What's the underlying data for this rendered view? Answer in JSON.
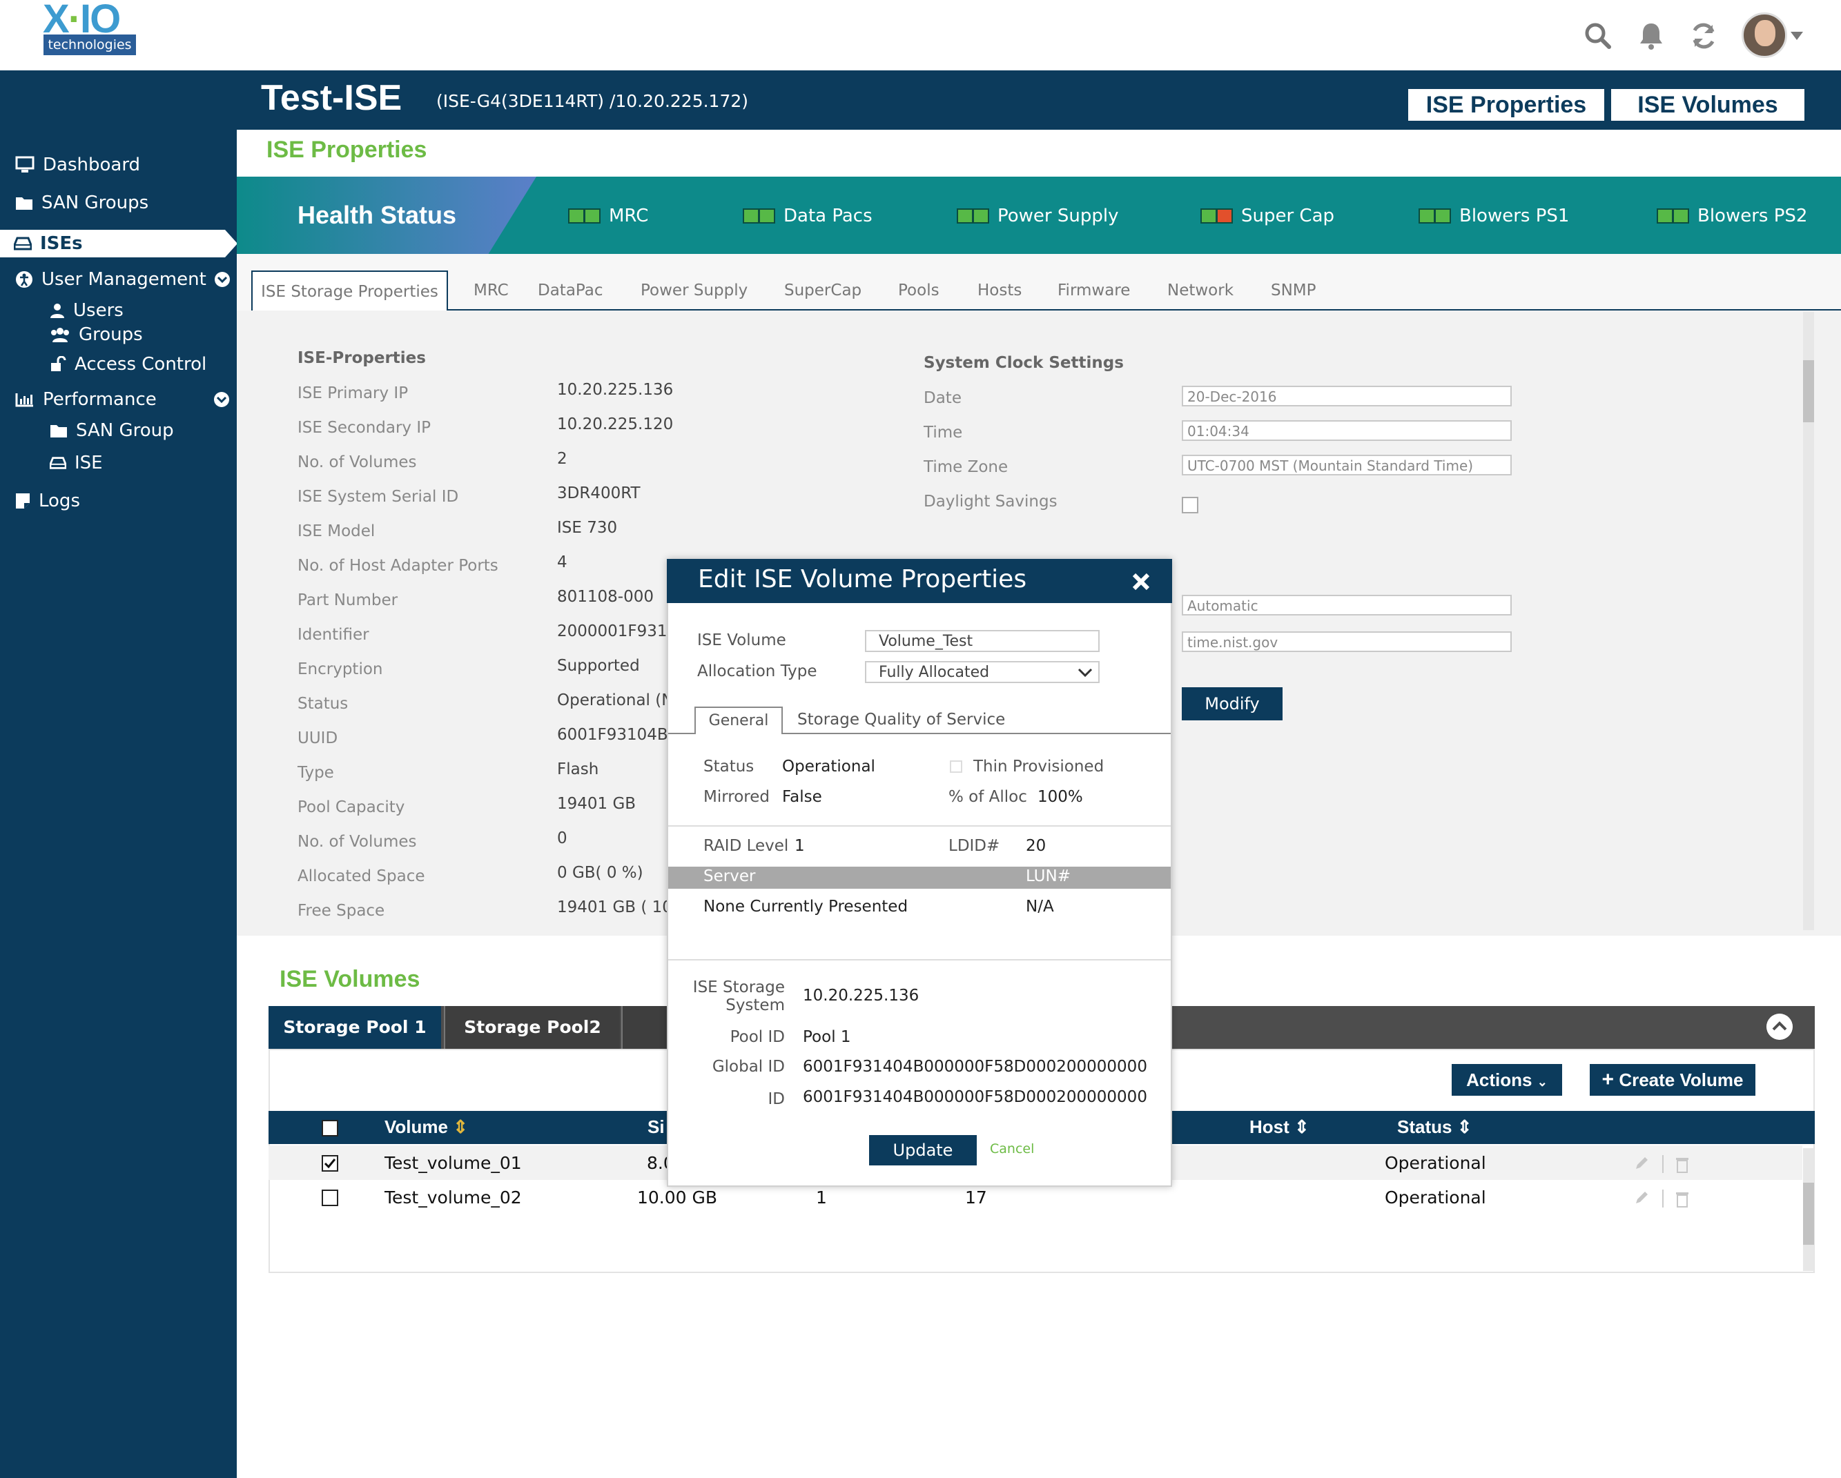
{
  "brand": {
    "logo_main": "X-IO",
    "logo_sub": "technologies"
  },
  "topbar_icons": [
    "search-icon",
    "bell-icon",
    "refresh-icon",
    "user-avatar"
  ],
  "sidebar": {
    "items": [
      {
        "label": "Dashboard",
        "icon": "monitor-icon"
      },
      {
        "label": "SAN Groups",
        "icon": "folder-icon"
      },
      {
        "label": "ISEs",
        "icon": "drive-icon",
        "active": true
      },
      {
        "label": "User Management",
        "icon": "accessibility-icon"
      },
      {
        "label": "Users",
        "icon": "user-icon"
      },
      {
        "label": "Groups",
        "icon": "users-icon"
      },
      {
        "label": "Access Control",
        "icon": "unlock-icon"
      },
      {
        "label": "Performance",
        "icon": "bar-chart-icon"
      },
      {
        "label": "SAN Group",
        "icon": "folder-icon"
      },
      {
        "label": "ISE",
        "icon": "drive-icon"
      },
      {
        "label": "Logs",
        "icon": "note-icon"
      }
    ]
  },
  "header": {
    "title": "Test-ISE",
    "subtitle": "(ISE-G4(3DE114RT) /10.20.225.172)",
    "btn_properties": "ISE Properties",
    "btn_volumes": "ISE Volumes"
  },
  "section_properties_title": "ISE Properties",
  "health": {
    "label": "Health Status",
    "items": [
      {
        "label": "MRC",
        "leds": [
          "green",
          "green"
        ]
      },
      {
        "label": "Data Pacs",
        "leds": [
          "green",
          "green"
        ]
      },
      {
        "label": "Power Supply",
        "leds": [
          "green",
          "green"
        ]
      },
      {
        "label": "Super Cap",
        "leds": [
          "green",
          "red"
        ]
      },
      {
        "label": "Blowers PS1",
        "leds": [
          "green",
          "green"
        ]
      },
      {
        "label": "Blowers PS2",
        "leds": [
          "green",
          "green"
        ]
      }
    ]
  },
  "tabs": [
    "ISE Storage Properties",
    "MRC",
    "DataPac",
    "Power Supply",
    "SuperCap",
    "Pools",
    "Hosts",
    "Firmware",
    "Network",
    "SNMP"
  ],
  "properties": {
    "heading": "ISE-Properties",
    "rows": [
      {
        "label": "ISE Primary IP",
        "value": "10.20.225.136"
      },
      {
        "label": "ISE Secondary IP",
        "value": "10.20.225.120"
      },
      {
        "label": "No. of Volumes",
        "value": "2"
      },
      {
        "label": "ISE System Serial ID",
        "value": "3DR400RT"
      },
      {
        "label": "ISE Model",
        "value": "ISE 730"
      },
      {
        "label": "No. of Host Adapter Ports",
        "value": "4"
      },
      {
        "label": "Part Number",
        "value": "801108-000"
      },
      {
        "label": "Identifier",
        "value": "2000001F931("
      },
      {
        "label": "Encryption",
        "value": "Supported"
      },
      {
        "label": "Status",
        "value": "Operational (N"
      },
      {
        "label": "UUID",
        "value": "6001F93104B("
      },
      {
        "label": "Type",
        "value": "Flash"
      },
      {
        "label": "Pool Capacity",
        "value": "19401 GB"
      },
      {
        "label": "No. of Volumes",
        "value": "0"
      },
      {
        "label": "Allocated Space",
        "value": "0 GB( 0 %)"
      },
      {
        "label": "Free Space",
        "value": "19401 GB ( 10"
      }
    ]
  },
  "clock": {
    "heading": "System Clock Settings",
    "date_label": "Date",
    "date_value": "20-Dec-2016",
    "time_label": "Time",
    "time_value": "01:04:34",
    "tz_label": "Time Zone",
    "tz_value": "UTC-0700 MST (Mountain Standard Time)",
    "dst_label": "Daylight Savings",
    "ntp_mode": "Automatic",
    "ntp_server": "time.nist.gov",
    "modify_label": "Modify"
  },
  "volumes": {
    "title": "ISE Volumes",
    "pools": [
      "Storage Pool 1",
      "Storage Pool2"
    ],
    "actions_label": "Actions",
    "create_label": "Create Volume",
    "columns": [
      "Volume",
      "Si",
      "Host",
      "Status"
    ],
    "rows": [
      {
        "name": "Test_volume_01",
        "size": "8.0",
        "c3": "",
        "c4": "",
        "status": "Operational",
        "checked": true
      },
      {
        "name": "Test_volume_02",
        "size": "10.00 GB",
        "c3": "1",
        "c4": "17",
        "status": "Operational",
        "checked": false
      }
    ]
  },
  "modal": {
    "title": "Edit ISE Volume Properties",
    "volume_label": "ISE  Volume",
    "volume_value": "Volume_Test",
    "alloc_label": "Allocation Type",
    "alloc_value": "Fully Allocated",
    "tab_general": "General",
    "tab_qos": "Storage Quality of Service",
    "status_label": "Status",
    "status_value": "Operational",
    "thin_label": "Thin Provisioned",
    "mirrored_label": "Mirrored",
    "mirrored_value": "False",
    "alloc_pct_label": "% of Alloc",
    "alloc_pct_value": "100%",
    "raid_label": "RAID Level",
    "raid_value": "1",
    "ldid_label": "LDID#",
    "ldid_value": "20",
    "server_head": "Server",
    "lun_head": "LUN#",
    "server_value": "None Currently Presented",
    "lun_value": "N/A",
    "storage_label_1": "ISE Storage",
    "storage_label_2": "System",
    "storage_value": "10.20.225.136",
    "pool_label": "Pool ID",
    "pool_value": "Pool 1",
    "global_label": "Global ID",
    "global_value": "6001F931404B000000F58D000200000000",
    "id_label": "ID",
    "id_value": "6001F931404B000000F58D000200000000",
    "update_label": "Update",
    "cancel_label": "Cancel"
  },
  "colors": {
    "navy": "#0c3b5c",
    "teal": "#0d8a8a",
    "green": "#6dbb45",
    "led_green": "#57b947",
    "led_red": "#e2502c"
  }
}
